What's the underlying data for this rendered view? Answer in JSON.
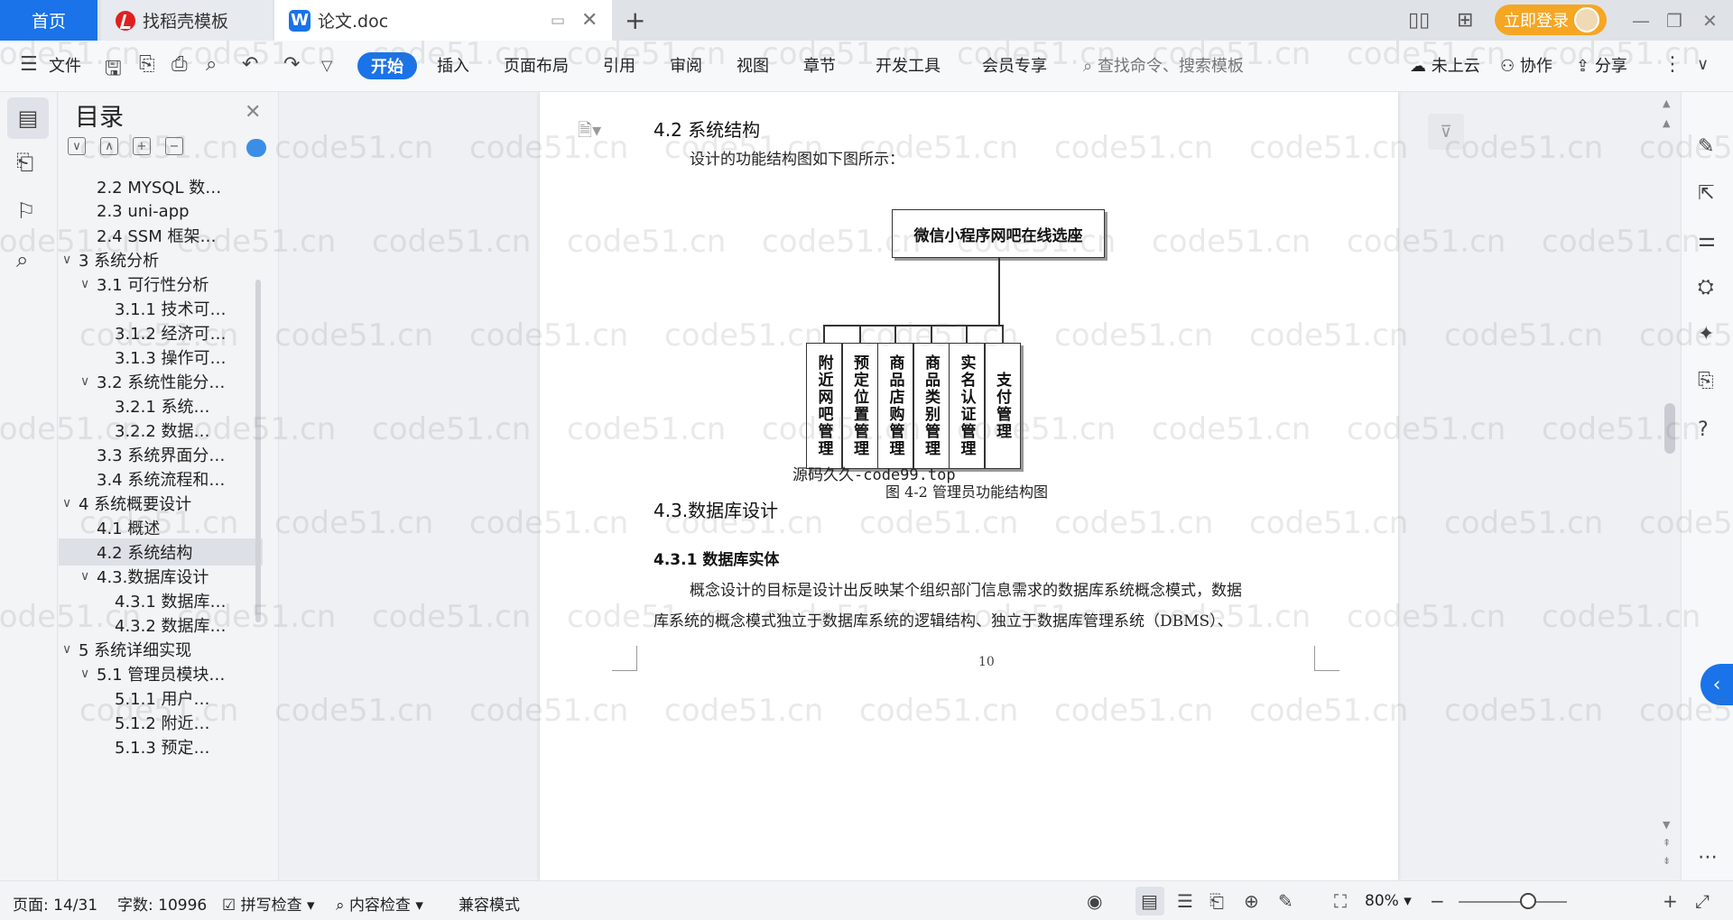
{
  "tabs": {
    "home": "首页",
    "template": "找稻壳模板",
    "doc": "论文.doc",
    "new_tab": "+",
    "login": "立即登录"
  },
  "menu": {
    "file": "文件",
    "items": [
      "开始",
      "插入",
      "页面布局",
      "引用",
      "审阅",
      "视图",
      "章节",
      "开发工具",
      "会员专享"
    ],
    "search": "查找命令、搜索模板",
    "cloud": "未上云",
    "collab": "协作",
    "share": "分享"
  },
  "toc": {
    "title": "目录",
    "items": [
      {
        "label": "2.2 MYSQL 数…",
        "level": 2,
        "chev": ""
      },
      {
        "label": "2.3 uni-app",
        "level": 2,
        "chev": ""
      },
      {
        "label": "2.4 SSM 框架…",
        "level": 2,
        "chev": ""
      },
      {
        "label": "3 系统分析",
        "level": 1,
        "chev": "∨"
      },
      {
        "label": "3.1 可行性分析",
        "level": 2,
        "chev": "∨"
      },
      {
        "label": "3.1.1 技术可…",
        "level": 3,
        "chev": ""
      },
      {
        "label": "3.1.2 经济可…",
        "level": 3,
        "chev": ""
      },
      {
        "label": "3.1.3 操作可…",
        "level": 3,
        "chev": ""
      },
      {
        "label": "3.2 系统性能分…",
        "level": 2,
        "chev": "∨"
      },
      {
        "label": "3.2.1  系统…",
        "level": 3,
        "chev": ""
      },
      {
        "label": "3.2.2  数据…",
        "level": 3,
        "chev": ""
      },
      {
        "label": "3.3 系统界面分…",
        "level": 2,
        "chev": ""
      },
      {
        "label": "3.4 系统流程和…",
        "level": 2,
        "chev": ""
      },
      {
        "label": "4 系统概要设计",
        "level": 1,
        "chev": "∨"
      },
      {
        "label": "4.1 概述",
        "level": 2,
        "chev": ""
      },
      {
        "label": "4.2 系统结构",
        "level": 2,
        "chev": "",
        "selected": true
      },
      {
        "label": "4.3.数据库设计",
        "level": 2,
        "chev": "∨"
      },
      {
        "label": "4.3.1 数据库…",
        "level": 3,
        "chev": ""
      },
      {
        "label": "4.3.2 数据库…",
        "level": 3,
        "chev": ""
      },
      {
        "label": "5 系统详细实现",
        "level": 1,
        "chev": "∨"
      },
      {
        "label": "5.1  管理员模块…",
        "level": 2,
        "chev": "∨"
      },
      {
        "label": "5.1.1  用户…",
        "level": 3,
        "chev": ""
      },
      {
        "label": "5.1.2  附近…",
        "level": 3,
        "chev": ""
      },
      {
        "label": "5.1.3  预定…",
        "level": 3,
        "chev": ""
      }
    ]
  },
  "document": {
    "h_42": "4.2 系统结构",
    "intro": "设计的功能结构图如下图所示：",
    "diagram": {
      "root": "微信小程序网吧在线选座",
      "children": [
        "附近网吧管理",
        "预定位置管理",
        "商品店购管理",
        "商品类别管理",
        "实名认证管理",
        "支付管理"
      ]
    },
    "source_note": "源码久久-code99.top",
    "caption": "图 4-2 管理员功能结构图",
    "h_43": "4.3.数据库设计",
    "h_431": "4.3.1 数据库实体",
    "p1": "概念设计的目标是设计出反映某个组织部门信息需求的数据库系统概念模式，数据",
    "p2": "库系统的概念模式独立于数据库系统的逻辑结构、独立于数据库管理系统（DBMS）、",
    "page_number": "10"
  },
  "watermark": "code51.cn",
  "status": {
    "page": "页面: 14/31",
    "words": "字数: 10996",
    "spell": "拼写检查",
    "content_check": "内容检查",
    "compat": "兼容模式",
    "zoom": "80%"
  }
}
